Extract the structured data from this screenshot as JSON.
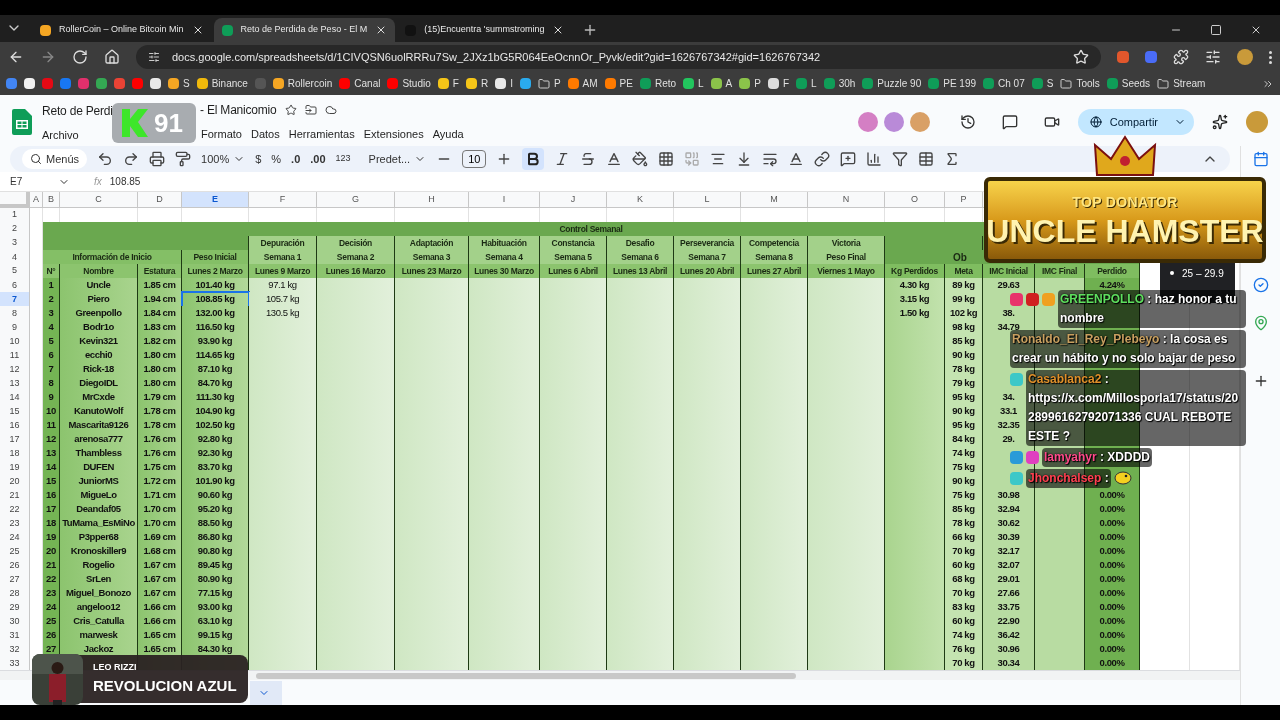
{
  "browser": {
    "tabs": [
      {
        "title": "RollerCoin – Online Bitcoin Min",
        "selected": false,
        "color": "#f5a623"
      },
      {
        "title": "Reto de Perdida de Peso - El M",
        "selected": true,
        "color": "#0f9d58"
      },
      {
        "title": "(15)Encuentra 'summstroming",
        "selected": false,
        "color": "#111111"
      }
    ],
    "url": "docs.google.com/spreadsheets/d/1CIVQSN6uolRRRu7Sw_2JXz1bG5R064EeOcnnOr_Pyvk/edit?gid=1626767342#gid=1626767342",
    "bookmarks": [
      {
        "kind": "site",
        "color": "#4285f4"
      },
      {
        "kind": "site",
        "color": "#f1f1f1"
      },
      {
        "kind": "site",
        "color": "#e50914"
      },
      {
        "kind": "site",
        "color": "#1877f2"
      },
      {
        "kind": "site",
        "color": "#e1306c"
      },
      {
        "kind": "site",
        "color": "#34a853"
      },
      {
        "kind": "site",
        "color": "#ea4335"
      },
      {
        "kind": "site",
        "color": "#ff0000"
      },
      {
        "kind": "site",
        "color": "#e8e8e8"
      },
      {
        "kind": "site",
        "color": "#f5a623",
        "label": "S"
      },
      {
        "kind": "site",
        "color": "#f0b90b",
        "label": "Binance"
      },
      {
        "kind": "site",
        "color": "#555555"
      },
      {
        "kind": "site",
        "color": "#f5a623",
        "label": "Rollercoin"
      },
      {
        "kind": "site",
        "color": "#ff0000",
        "label": "Canal"
      },
      {
        "kind": "site",
        "color": "#ff0000",
        "label": "Studio"
      },
      {
        "kind": "site",
        "color": "#f5c518",
        "label": "F"
      },
      {
        "kind": "site",
        "color": "#f5c518",
        "label": "R"
      },
      {
        "kind": "site",
        "color": "#e8e8e8",
        "label": "I"
      },
      {
        "kind": "site",
        "color": "#2aabee"
      },
      {
        "kind": "folder",
        "label": "P"
      },
      {
        "kind": "site",
        "color": "#ff7a00",
        "label": "AM"
      },
      {
        "kind": "site",
        "color": "#ff7a00",
        "label": "PE"
      },
      {
        "kind": "site",
        "color": "#0f9d58",
        "label": "Reto"
      },
      {
        "kind": "site",
        "color": "#22c55e",
        "label": "L"
      },
      {
        "kind": "site",
        "color": "#8bc34a",
        "label": "A"
      },
      {
        "kind": "site",
        "color": "#8bc34a",
        "label": "P"
      },
      {
        "kind": "site",
        "color": "#dddddd",
        "label": "F"
      },
      {
        "kind": "site",
        "color": "#0f9d58",
        "label": "L"
      },
      {
        "kind": "site",
        "color": "#0f9d58",
        "label": "30h"
      },
      {
        "kind": "site",
        "color": "#0f9d58",
        "label": "Puzzle 90"
      },
      {
        "kind": "site",
        "color": "#0f9d58",
        "label": "PE 199"
      },
      {
        "kind": "site",
        "color": "#0f9d58",
        "label": "Ch 07"
      },
      {
        "kind": "site",
        "color": "#0f9d58",
        "label": "S"
      },
      {
        "kind": "folder",
        "label": "Tools"
      },
      {
        "kind": "site",
        "color": "#0f9d58",
        "label": "Seeds"
      },
      {
        "kind": "folder",
        "label": "Stream"
      }
    ]
  },
  "doc": {
    "title_parts": [
      "Reto de Perdi",
      "- El Manicomio"
    ],
    "menu_left": [
      "Archivo"
    ],
    "menu_right": [
      "Formato",
      "Datos",
      "Herramientas",
      "Extensiones",
      "Ayuda"
    ],
    "collaborators": [
      {
        "color": "#d47fc4"
      },
      {
        "color": "#b98ad8"
      },
      {
        "color": "#d9a066"
      }
    ],
    "share": "Compartir"
  },
  "toolbar": {
    "search": "Menús",
    "zoom": "100%",
    "currency": "$",
    "percent": "%",
    "decrease_decimals": ".0",
    "increase_decimals": ".00",
    "number_format": "123",
    "font": "Predet...",
    "font_size": "10",
    "bold_active": true
  },
  "formula_bar": {
    "cell": "E7",
    "fx": "fx",
    "value": "108.85"
  },
  "columns": [
    {
      "letter": "A",
      "selected": false
    },
    {
      "letter": "B",
      "selected": false
    },
    {
      "letter": "C",
      "selected": false
    },
    {
      "letter": "D",
      "selected": false
    },
    {
      "letter": "E",
      "selected": true
    },
    {
      "letter": "F",
      "selected": false
    },
    {
      "letter": "G",
      "selected": false
    },
    {
      "letter": "H",
      "selected": false
    },
    {
      "letter": "I",
      "selected": false
    },
    {
      "letter": "J",
      "selected": false
    },
    {
      "letter": "K",
      "selected": false
    },
    {
      "letter": "L",
      "selected": false
    },
    {
      "letter": "M",
      "selected": false
    },
    {
      "letter": "N",
      "selected": false
    },
    {
      "letter": "O",
      "selected": false
    },
    {
      "letter": "P",
      "selected": false
    }
  ],
  "row_numbers": [
    "1",
    "2",
    "3",
    "4",
    "5",
    "6",
    "7",
    "8",
    "9",
    "10",
    "11",
    "12",
    "13",
    "14",
    "15",
    "16",
    "17",
    "18",
    "19",
    "20",
    "21",
    "22",
    "23",
    "24",
    "25",
    "26",
    "27",
    "28",
    "29",
    "30",
    "31",
    "32",
    "33"
  ],
  "sheet": {
    "title": "Control Semanal",
    "info_group": "Información de Inicio",
    "goal_group": "Ob",
    "phases": [
      "Depuración",
      "Decisión",
      "Adaptación",
      "Habituación",
      "Constancia",
      "Desafio",
      "Perseverancia",
      "Competencia",
      "Victoria"
    ],
    "weeks": [
      "Peso Inicial",
      "Semana 1",
      "Semana 2",
      "Semana 3",
      "Semana 4",
      "Semana 5",
      "Semana 6",
      "Semana 7",
      "Semana 8",
      "Peso Final"
    ],
    "headers": [
      "N°",
      "Nombre",
      "Estatura",
      "Lunes 2 Marzo",
      "Lunes 9 Marzo",
      "Lunes 16 Marzo",
      "Lunes 23 Marzo",
      "Lunes 30 Marzo",
      "Lunes 6 Abril",
      "Lunes 13 Abril",
      "Lunes 20 Abril",
      "Lunes 27 Abril",
      "Viernes 1 Mayo",
      "Kg Perdidos",
      "Meta",
      "IMC Inicial",
      "IMC Final",
      "Perdido"
    ]
  },
  "participants": [
    {
      "n": "1",
      "name": "Uncle",
      "height": "1.85 cm",
      "weight": "101.40 kg",
      "week1": "97.1 kg",
      "lost": "4.30 kg",
      "goal": "89 kg",
      "bmi": "29.63",
      "pct": "4.24%",
      "selected": false
    },
    {
      "n": "2",
      "name": "Piero",
      "height": "1.94 cm",
      "weight": "108.85 kg",
      "week1": "105.7 kg",
      "lost": "3.15 kg",
      "goal": "99 kg",
      "selected": true
    },
    {
      "n": "3",
      "name": "Greenpollo",
      "height": "1.84 cm",
      "weight": "132.00 kg",
      "week1": "130.5 kg",
      "lost": "1.50 kg",
      "goal": "102 kg",
      "bmi": "38.",
      "selected": false
    },
    {
      "n": "4",
      "name": "Bodr1o",
      "height": "1.83 cm",
      "weight": "116.50 kg",
      "goal": "98 kg",
      "bmi": "34.79",
      "selected": false
    },
    {
      "n": "5",
      "name": "Kevin321",
      "height": "1.82 cm",
      "weight": "93.90 kg",
      "goal": "85 kg",
      "selected": false
    },
    {
      "n": "6",
      "name": "ecchi0",
      "height": "1.80 cm",
      "weight": "114.65 kg",
      "goal": "90 kg",
      "selected": false
    },
    {
      "n": "7",
      "name": "Rick-18",
      "height": "1.80 cm",
      "weight": "87.10 kg",
      "goal": "78 kg",
      "selected": false
    },
    {
      "n": "8",
      "name": "DiegoIDL",
      "height": "1.80 cm",
      "weight": "84.70 kg",
      "goal": "79 kg",
      "selected": false
    },
    {
      "n": "9",
      "name": "MrCxde",
      "height": "1.79 cm",
      "weight": "111.30 kg",
      "goal": "95 kg",
      "bmi": "34.",
      "selected": false
    },
    {
      "n": "10",
      "name": "KanutoWolf",
      "height": "1.78 cm",
      "weight": "104.90 kg",
      "goal": "90 kg",
      "bmi": "33.1",
      "selected": false
    },
    {
      "n": "11",
      "name": "Mascarita9126",
      "height": "1.78 cm",
      "weight": "102.50 kg",
      "goal": "95 kg",
      "bmi": "32.35",
      "selected": false
    },
    {
      "n": "12",
      "name": "arenosa777",
      "height": "1.76 cm",
      "weight": "92.80 kg",
      "goal": "84 kg",
      "bmi": "29.",
      "selected": false
    },
    {
      "n": "13",
      "name": "Thambless",
      "height": "1.76 cm",
      "weight": "92.30 kg",
      "goal": "74 kg",
      "selected": false
    },
    {
      "n": "14",
      "name": "DUFEN",
      "height": "1.75 cm",
      "weight": "83.70 kg",
      "goal": "75 kg",
      "selected": false
    },
    {
      "n": "15",
      "name": "JuniorMS",
      "height": "1.72 cm",
      "weight": "101.90 kg",
      "goal": "90 kg",
      "selected": false
    },
    {
      "n": "16",
      "name": "MigueLo",
      "height": "1.71 cm",
      "weight": "90.60 kg",
      "goal": "75 kg",
      "bmi": "30.98",
      "pct": "0.00%",
      "selected": false
    },
    {
      "n": "17",
      "name": "Deandaf05",
      "height": "1.70 cm",
      "weight": "95.20 kg",
      "goal": "85 kg",
      "bmi": "32.94",
      "pct": "0.00%",
      "selected": false
    },
    {
      "n": "18",
      "name": "TuMama_EsMiNo",
      "height": "1.70 cm",
      "weight": "88.50 kg",
      "goal": "78 kg",
      "bmi": "30.62",
      "pct": "0.00%",
      "selected": false
    },
    {
      "n": "19",
      "name": "P3pper68",
      "height": "1.69 cm",
      "weight": "86.80 kg",
      "goal": "66 kg",
      "bmi": "30.39",
      "pct": "0.00%",
      "selected": false
    },
    {
      "n": "20",
      "name": "Kronoskiller9",
      "height": "1.68 cm",
      "weight": "90.80 kg",
      "goal": "70 kg",
      "bmi": "32.17",
      "pct": "0.00%",
      "selected": false
    },
    {
      "n": "21",
      "name": "Rogelio",
      "height": "1.67 cm",
      "weight": "89.45 kg",
      "goal": "60 kg",
      "bmi": "32.07",
      "pct": "0.00%",
      "selected": false
    },
    {
      "n": "22",
      "name": "SrLen",
      "height": "1.67 cm",
      "weight": "80.90 kg",
      "goal": "68 kg",
      "bmi": "29.01",
      "pct": "0.00%",
      "selected": false
    },
    {
      "n": "23",
      "name": "Miguel_Bonozo",
      "height": "1.67 cm",
      "weight": "77.15 kg",
      "goal": "70 kg",
      "bmi": "27.66",
      "pct": "0.00%",
      "selected": false
    },
    {
      "n": "24",
      "name": "angeloo12",
      "height": "1.66 cm",
      "weight": "93.00 kg",
      "goal": "83 kg",
      "bmi": "33.75",
      "pct": "0.00%",
      "selected": false
    },
    {
      "n": "25",
      "name": "Cris_Catulla",
      "height": "1.66 cm",
      "weight": "63.10 kg",
      "goal": "60 kg",
      "bmi": "22.90",
      "pct": "0.00%",
      "selected": false
    },
    {
      "n": "26",
      "name": "marwesk",
      "height": "1.65 cm",
      "weight": "99.15 kg",
      "goal": "74 kg",
      "bmi": "36.42",
      "pct": "0.00%",
      "selected": false
    },
    {
      "n": "27",
      "name": "Jackoz",
      "height": "1.65 cm",
      "weight": "84.30 kg",
      "goal": "76 kg",
      "bmi": "30.96",
      "pct": "0.00%",
      "selected": false
    },
    {
      "goal": "70 kg",
      "bmi": "30.34",
      "pct": "0.00%",
      "selected": false
    }
  ],
  "overlays": {
    "counter": "91",
    "banner": {
      "top": "TOP DONATOR",
      "name": "UNCLE HAMSTER"
    },
    "tooltip": "25 – 29.9",
    "chat": [
      {
        "user": "GREENPOLLO",
        "color": "#5ee05e",
        "text": " : haz honor a tu nombre",
        "badges": [
          {
            "color": "#e8336b"
          },
          {
            "color": "#d02020"
          },
          {
            "color": "#f0a020"
          }
        ]
      },
      {
        "user": "Ronaldo_El_Rey_Plebeyo",
        "color": "#c8a060",
        "text": " : la cosa es crear un hábito y no solo bajar de peso"
      },
      {
        "user": "Casablanca2",
        "color": "#e0902a",
        "text": " : https://x.com/Millosporla17/status/2028996162792071336 CUAL REBOTE ESTE ?",
        "badges": [
          {
            "color": "#3cc8c8"
          }
        ]
      },
      {
        "user": "Iamyahyr",
        "color": "#ff4a8a",
        "text": " : XDDDD",
        "badges": [
          {
            "color": "#2a9bd8"
          },
          {
            "color": "#e040c0"
          }
        ]
      },
      {
        "user": "Jhonchalsep",
        "color": "#ff4050",
        "text": " :",
        "badges": [
          {
            "color": "#3cc8c8"
          }
        ],
        "emote": true
      }
    ],
    "music": {
      "artist": "LEO RIZZI",
      "title": "REVOLUCION AZUL"
    }
  }
}
